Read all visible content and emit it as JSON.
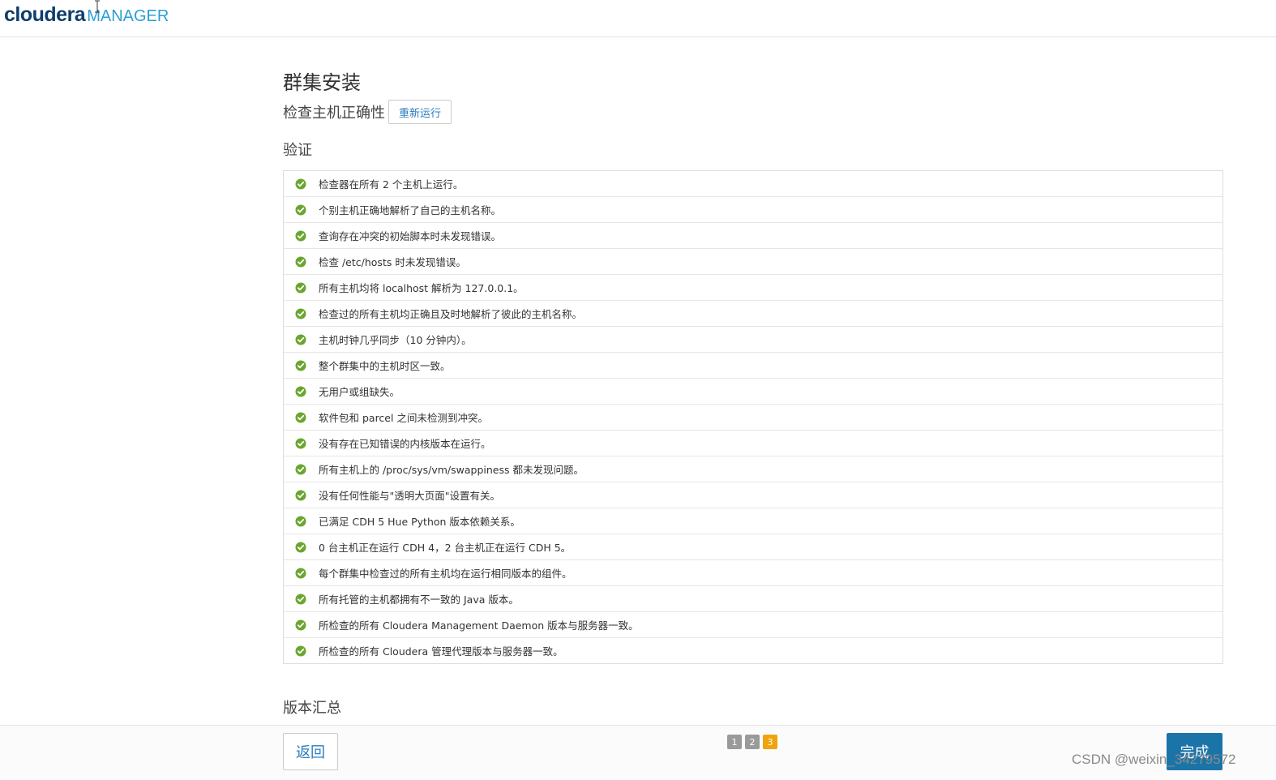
{
  "header": {
    "logo_primary": "cloudera",
    "logo_secondary": "MANAGER"
  },
  "page": {
    "title": "群集安装",
    "subtitle": "检查主机正确性",
    "rerun_label": "重新运行",
    "verify_heading": "验证",
    "version_heading": "版本汇总"
  },
  "checks": [
    {
      "text": "检查器在所有 2 个主机上运行。",
      "status": "success-icon"
    },
    {
      "text": "个别主机正确地解析了自己的主机名称。",
      "status": "success-icon"
    },
    {
      "text": "查询存在冲突的初始脚本时未发现错误。",
      "status": "success-icon"
    },
    {
      "text": "检查 /etc/hosts 时未发现错误。",
      "status": "success-icon"
    },
    {
      "text": "所有主机均将 localhost 解析为 127.0.0.1。",
      "status": "success-icon"
    },
    {
      "text": "检查过的所有主机均正确且及时地解析了彼此的主机名称。",
      "status": "success-icon"
    },
    {
      "text": "主机时钟几乎同步（10 分钟内）。",
      "status": "success-icon"
    },
    {
      "text": "整个群集中的主机时区一致。",
      "status": "success-icon"
    },
    {
      "text": "无用户或组缺失。",
      "status": "success-icon"
    },
    {
      "text": "软件包和 parcel 之间未检测到冲突。",
      "status": "success-icon"
    },
    {
      "text": "没有存在已知错误的内核版本在运行。",
      "status": "success-icon"
    },
    {
      "text": "所有主机上的 /proc/sys/vm/swappiness 都未发现问题。",
      "status": "success-icon"
    },
    {
      "text": "没有任何性能与\"透明大页面\"设置有关。",
      "status": "success-icon"
    },
    {
      "text": "已满足 CDH 5 Hue Python 版本依赖关系。",
      "status": "success-icon"
    },
    {
      "text": "0 台主机正在运行 CDH 4，2 台主机正在运行 CDH 5。",
      "status": "success-icon"
    },
    {
      "text": "每个群集中检查过的所有主机均在运行相同版本的组件。",
      "status": "success-icon"
    },
    {
      "text": "所有托管的主机都拥有不一致的 Java 版本。",
      "status": "success-icon"
    },
    {
      "text": "所检查的所有 Cloudera Management Daemon 版本与服务器一致。",
      "status": "success-icon"
    },
    {
      "text": "所检查的所有 Cloudera 管理代理版本与服务器一致。",
      "status": "success-icon"
    }
  ],
  "footer": {
    "back_label": "返回",
    "finish_label": "完成",
    "steps": [
      "1",
      "2",
      "3"
    ],
    "active_step": "3"
  },
  "watermark": "CSDN @weixin_34279572",
  "colors": {
    "accent": "#2a7bbf",
    "primary_button": "#1b74a8",
    "success": "#6aa62e",
    "active_step": "#f0a30a",
    "inactive_step": "#9a9a9a"
  }
}
